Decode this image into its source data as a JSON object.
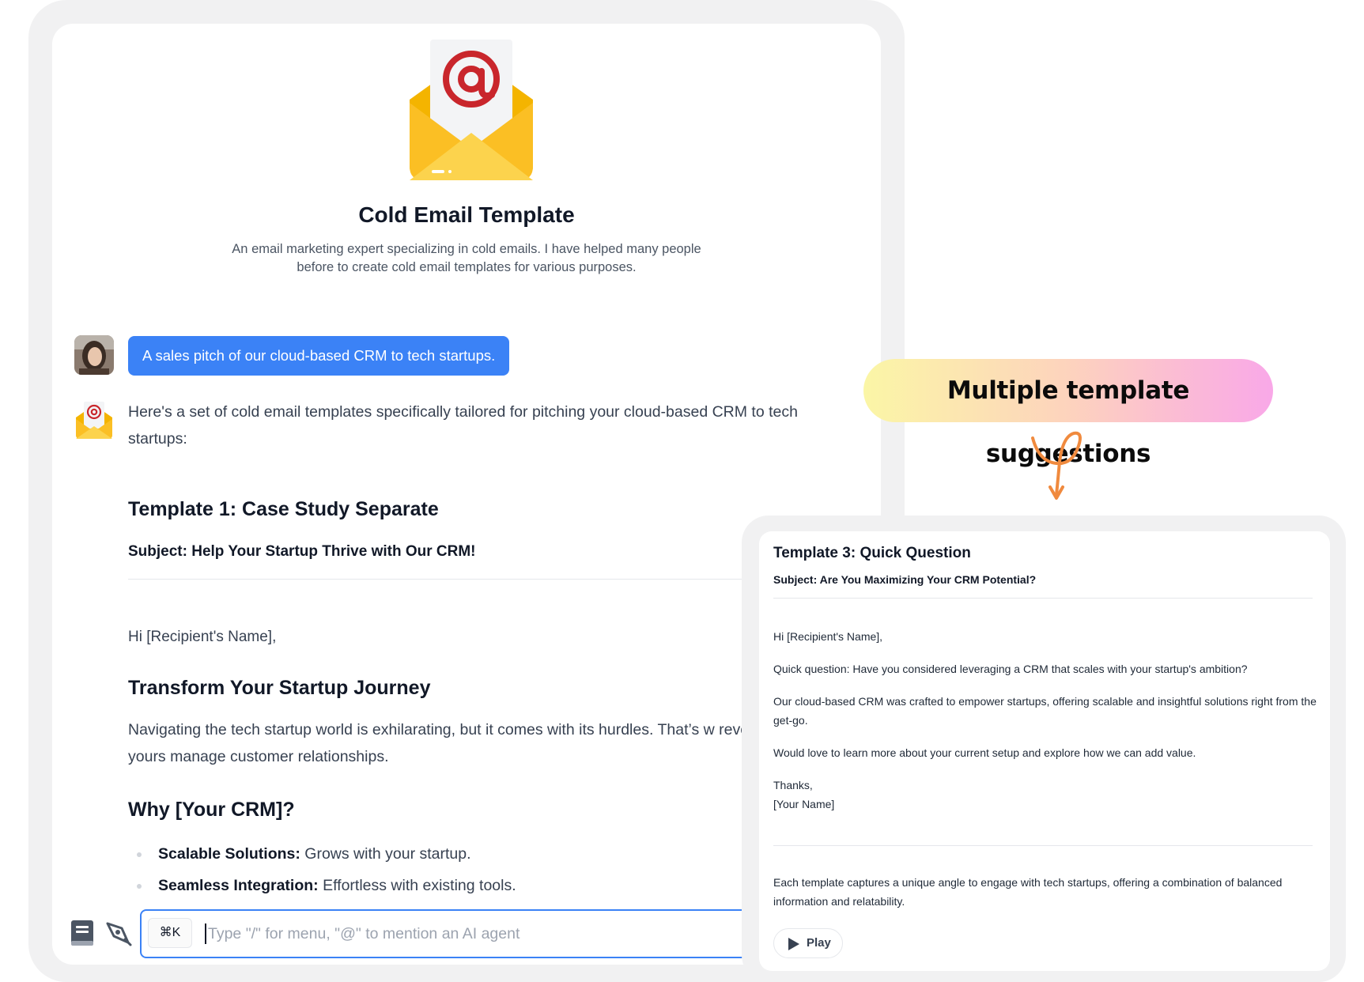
{
  "bot": {
    "title": "Cold Email Template",
    "description": "An email marketing expert specializing in cold emails. I have helped many people before to create cold email templates for various purposes.",
    "icon": "envelope-at-icon"
  },
  "user_message": "A sales pitch of our cloud-based CRM to tech startups.",
  "response": {
    "intro": "Here's a set of cold email templates specifically tailored for pitching your cloud-based CRM to tech startups:",
    "template1_title": "Template 1: Case Study Separate",
    "template1_subject": "Subject: Help Your Startup Thrive with Our CRM!",
    "greeting": "Hi [Recipient's Name],",
    "section1_heading": "Transform Your Startup Journey",
    "section1_paragraph": "Navigating the tech startup world is exhilarating, but it comes with its hurdles. That’s w revolutionizing the way startups like yours manage customer relationships.",
    "section2_heading": "Why [Your CRM]?",
    "bullets": [
      {
        "bold": "Scalable Solutions:",
        "text": " Grows with your startup."
      },
      {
        "bold": "Seamless Integration:",
        "text": " Effortless with existing tools."
      }
    ]
  },
  "composer": {
    "shortcut": "⌘K",
    "placeholder": "Type \"/\" for menu, \"@\" to mention an AI agent"
  },
  "callout": {
    "label": "Multiple template suggestions"
  },
  "template3_card": {
    "title": "Template 3: Quick Question",
    "subject": "Subject: Are You Maximizing Your CRM Potential?",
    "greeting": "Hi [Recipient's Name],",
    "line1": "Quick question: Have you considered leveraging a CRM that scales with your startup's ambition?",
    "line2": "Our cloud-based CRM was crafted to empower startups, offering scalable and insightful solutions right from the get-go.",
    "line3": "Would love to learn more about your current setup and explore how we can add value.",
    "signoff": "Thanks,",
    "signature": "[Your Name]",
    "summary": "Each template captures a unique angle to engage with tech startups, offering a combination of balanced information and relatability.",
    "play_label": "Play"
  },
  "colors": {
    "accent": "#3b82f6",
    "envelope": "#fbbf24",
    "at_sign": "#c9262c",
    "pill_gradient": [
      "#fbf6a6",
      "#fdd3bd",
      "#f9a8e8"
    ],
    "arrow": "#f08a3e"
  }
}
